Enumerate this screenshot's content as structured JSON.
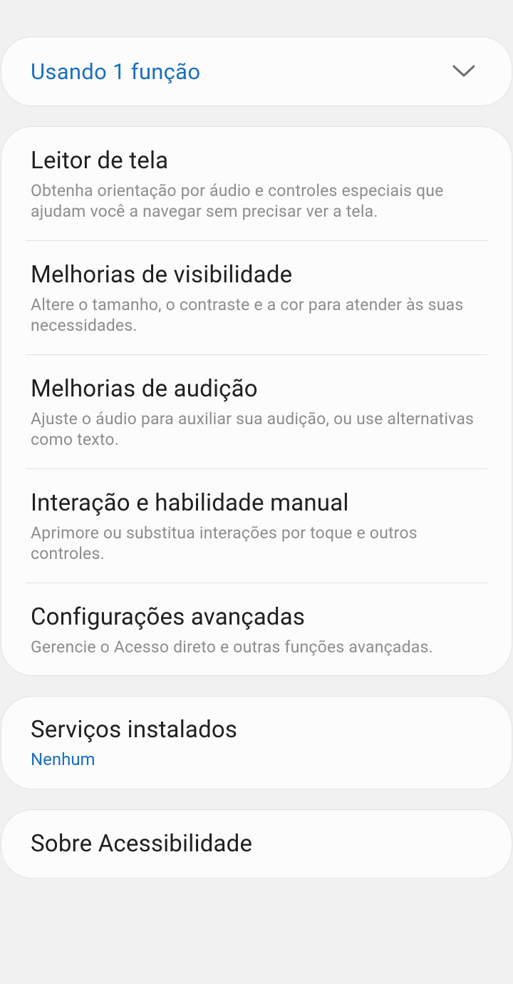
{
  "active_features": {
    "label": "Usando 1 função",
    "icon": "chevron-down-icon"
  },
  "categories": [
    {
      "title": "Leitor de tela",
      "description": "Obtenha orientação por áudio e controles especiais que ajudam você a navegar sem precisar ver a tela."
    },
    {
      "title": "Melhorias de visibilidade",
      "description": "Altere o tamanho, o contraste e a cor para atender às suas necessidades."
    },
    {
      "title": "Melhorias de audição",
      "description": "Ajuste o áudio para auxiliar sua audição, ou use alternativas como texto."
    },
    {
      "title": "Interação e habilidade manual",
      "description": "Aprimore ou substitua interações por toque e outros controles."
    },
    {
      "title": "Configurações avançadas",
      "description": "Gerencie o Acesso direto e outras funções avançadas."
    }
  ],
  "installed_services": {
    "title": "Serviços instalados",
    "value": "Nenhum"
  },
  "about": {
    "title": "Sobre Acessibilidade"
  },
  "colors": {
    "accent": "#1a6fbf",
    "background": "#f1f1f1",
    "card": "#fcfcfc",
    "title_text": "#202020",
    "secondary_text": "#8d8d8d"
  }
}
